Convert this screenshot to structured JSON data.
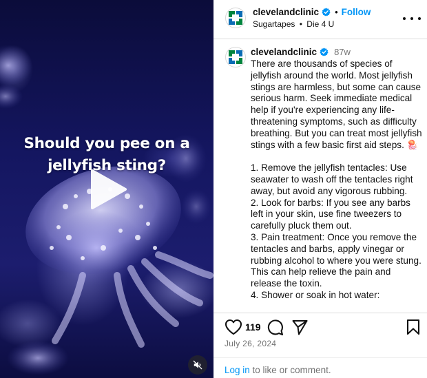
{
  "video": {
    "caption_line1": "Should you pee on a",
    "caption_line2": "jellyfish sting?",
    "play_icon": "play-icon",
    "mute_icon": "muted-speaker-icon"
  },
  "header": {
    "username": "clevelandclinic",
    "verified_icon": "verified-badge-icon",
    "separator": "•",
    "follow_label": "Follow",
    "audio": "Sugartapes",
    "audio_separator": "•",
    "audio_track": "Die 4 U",
    "more_icon": "more-options-icon"
  },
  "post": {
    "username": "clevelandclinic",
    "time_ago": "87w",
    "caption": "There are thousands of species of jellyfish around the world. Most jellyfish stings are harmless, but some can cause serious harm. Seek immediate medical help if you're experiencing any life-threatening symptoms, such as difficulty breathing. But you can treat most jellyfish stings with a few basic first aid steps. 🪼\n\n1. Remove the jellyfish tentacles: Use seawater to wash off the tentacles right away, but avoid any vigorous rubbing.\n2. Look for barbs: If you see any barbs left in your skin, use fine tweezers to carefully pluck them out.\n3. Pain treatment: Once you remove the tentacles and barbs, apply vinegar or rubbing alcohol to where you were stung. This can help relieve the pain and release the toxin.\n4. Shower or soak in hot water:"
  },
  "actions": {
    "like_icon": "heart-icon",
    "likes_count": "119",
    "comment_icon": "comment-bubble-icon",
    "share_icon": "paper-plane-icon",
    "save_icon": "bookmark-icon",
    "date": "July 26, 2024",
    "login_link": "Log in",
    "login_rest": " to like or comment."
  },
  "colors": {
    "link_blue": "#0095f6",
    "muted_text": "#737373",
    "clinic_green": "#00843d",
    "clinic_blue": "#0a6cb4"
  }
}
